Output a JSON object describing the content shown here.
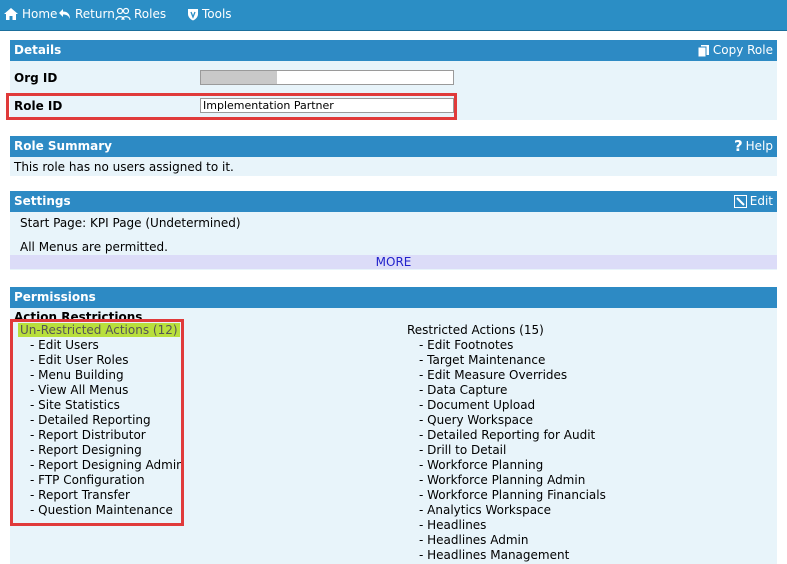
{
  "nav": {
    "home": "Home",
    "return": "Return",
    "roles": "Roles",
    "tools": "Tools"
  },
  "details": {
    "title": "Details",
    "copy_role": "Copy Role",
    "org_id_label": "Org ID",
    "org_id_value": "",
    "role_id_label": "Role ID",
    "role_id_value": "Implementation Partner"
  },
  "role_summary": {
    "title": "Role Summary",
    "help": "Help",
    "text": "This role has no users assigned to it."
  },
  "settings": {
    "title": "Settings",
    "edit": "Edit",
    "start_page": "Start Page: KPI Page (Undetermined)",
    "menus": "All Menus are permitted.",
    "more": "MORE"
  },
  "permissions": {
    "title": "Permissions",
    "section": "Action Restrictions",
    "unrestricted_title": "Un-Restricted Actions (12)",
    "unrestricted": [
      "- Edit Users",
      "- Edit User Roles",
      "- Menu Building",
      "- View All Menus",
      "- Site Statistics",
      "- Detailed Reporting",
      "- Report Distributor",
      "- Report Designing",
      "- Report Designing Admin",
      "- FTP Configuration",
      "- Report Transfer",
      "- Question Maintenance"
    ],
    "restricted_title": "Restricted Actions (15)",
    "restricted": [
      "- Edit Footnotes",
      "- Target Maintenance",
      "- Edit Measure Overrides",
      "- Data Capture",
      "- Document Upload",
      "- Query Workspace",
      "- Detailed Reporting for Audit",
      "- Drill to Detail",
      "- Workforce Planning",
      "- Workforce Planning Admin",
      "- Workforce Planning Financials",
      "- Analytics Workspace",
      "- Headlines",
      "- Headlines Admin",
      "- Headlines Management"
    ]
  },
  "colors": {
    "header": "#2d8ac4",
    "panel": "#e8f4fa",
    "annotation": "#e03a3a",
    "highlight": "#b8df3c"
  }
}
